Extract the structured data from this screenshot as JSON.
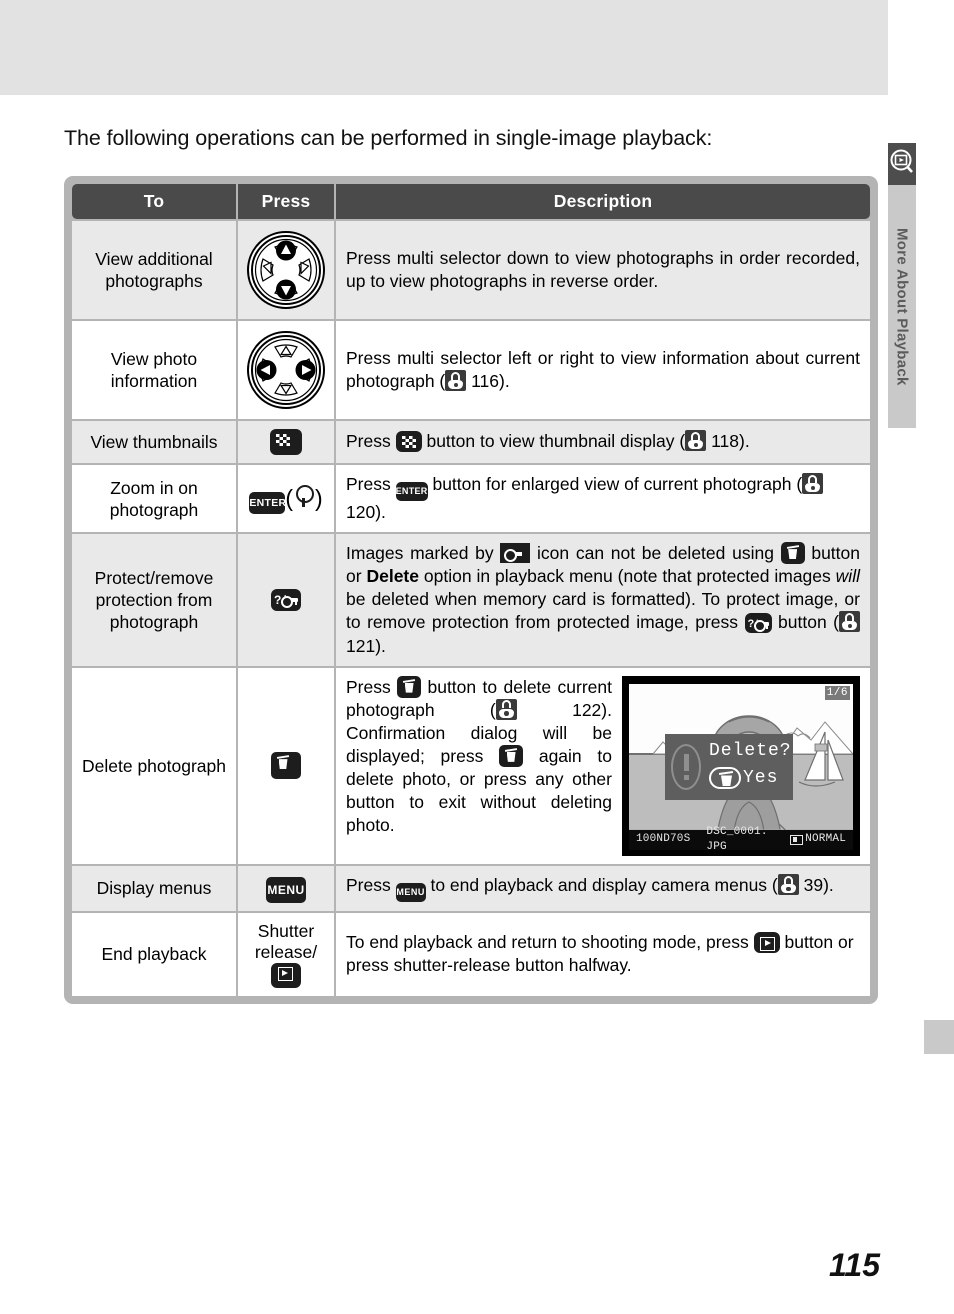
{
  "sidebar": {
    "label": "More About Playback",
    "icon": "playback-magnifier-icon"
  },
  "intro": "The following operations can be performed in single-image playback:",
  "table": {
    "headers": {
      "to": "To",
      "press": "Press",
      "description": "Description"
    },
    "rows": [
      {
        "to": "View additional photographs",
        "press_icon": "multi-selector-up-down-icon",
        "description_pre": "Press multi selector down to view photographs in order recorded, up to view photographs in reverse order.",
        "description_post": ""
      },
      {
        "to": "View photo information",
        "press_icon": "multi-selector-left-right-icon",
        "description_pre": "Press multi selector left or right to view information about current photograph (",
        "ref_page": "116",
        "description_post": ")."
      },
      {
        "to": "View thumbnails",
        "press_icon": "thumbnail-button-icon",
        "description_pre": "Press ",
        "description_mid": " button to view thumbnail display (",
        "ref_page": "118",
        "description_post": ")."
      },
      {
        "to": "Zoom in on photograph",
        "press_icon": "enter-button-magnifier-icon",
        "description_pre": "Press ",
        "description_mid": " button for enlarged view of current photograph (",
        "ref_page": "120",
        "description_post": ")."
      },
      {
        "to": "Protect/remove protection from photograph",
        "press_icon": "protect-button-icon",
        "seg1": "Images marked by ",
        "seg2": " icon can not be deleted using ",
        "seg3": " button or ",
        "strong": "Delete",
        "seg4": " option in playback menu (note that protected images ",
        "italic": "will",
        "seg5": " be deleted when memory card is formatted).  To protect image, or to remove protection from protected image, press ",
        "seg6": " button (",
        "ref_page": "121",
        "seg7": ")."
      },
      {
        "to": "Delete photograph",
        "press_icon": "delete-button-icon",
        "seg1": "Press ",
        "seg2": " button to delete current photograph (",
        "ref_page": "122",
        "seg3": "). Confirmation dialog will be displayed; press ",
        "seg4": " again to delete photo, or press any other button to exit without deleting photo."
      },
      {
        "to": "Display menus",
        "press_icon": "menu-button-icon",
        "press_label": "MENU",
        "seg1": "Press ",
        "seg2": " to end playback and display camera menus (",
        "ref_page": "39",
        "seg3": ")."
      },
      {
        "to": "End playback",
        "press_label_line1": "Shutter",
        "press_label_line2": "release/",
        "press_icon": "playback-button-icon",
        "seg1": "To end playback and return to shooting mode, press ",
        "seg2": " button or press shutter-release button halfway."
      }
    ]
  },
  "lcd": {
    "frame_number": "1/6",
    "dialog_title": "Delete?",
    "dialog_confirm": "Yes",
    "folder": "100ND70S",
    "filename": "DSC_0001. JPG",
    "quality": "NORMAL"
  },
  "page_number": "115",
  "button_labels": {
    "menu": "MENU",
    "enter": "ENTER"
  },
  "colors": {
    "header_bg": "#4a4a4a",
    "table_border": "#b4b4b4",
    "alt_row_bg": "#e9e9e9",
    "top_band": "#e2e2e2",
    "sidebar_bg": "#c9c9c9",
    "sidebar_text": "#5b5b5b"
  }
}
